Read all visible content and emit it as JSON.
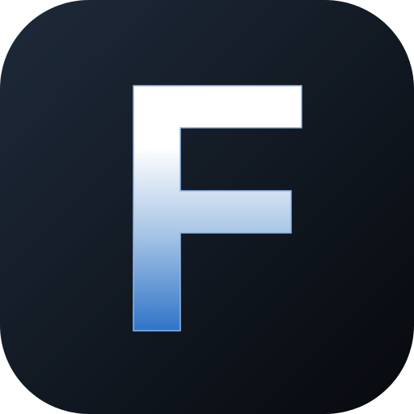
{
  "app_icon": {
    "letter": "F",
    "colors": {
      "background_top": "#1e2a3a",
      "background_bottom": "#07090d",
      "letter_top": "#ffffff",
      "letter_mid": "#a9c6e6",
      "letter_bottom": "#2f74c8",
      "letter_outline": "#8fb7e6"
    }
  }
}
